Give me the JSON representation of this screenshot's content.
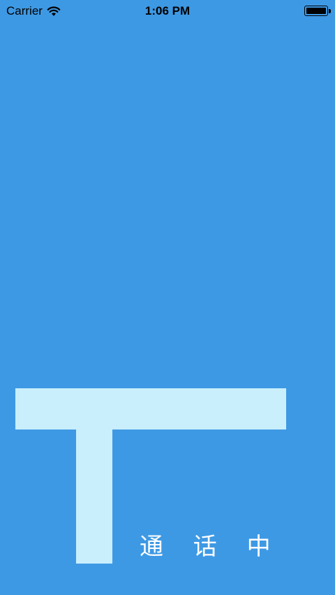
{
  "status_bar": {
    "carrier": "Carrier",
    "time": "1:06 PM",
    "wifi_icon": "wifi-icon",
    "battery_icon": "battery-full-icon"
  },
  "main": {
    "background_color": "#3e99e4",
    "logo_color": "#c9effc",
    "call_status": "通 话 中"
  }
}
